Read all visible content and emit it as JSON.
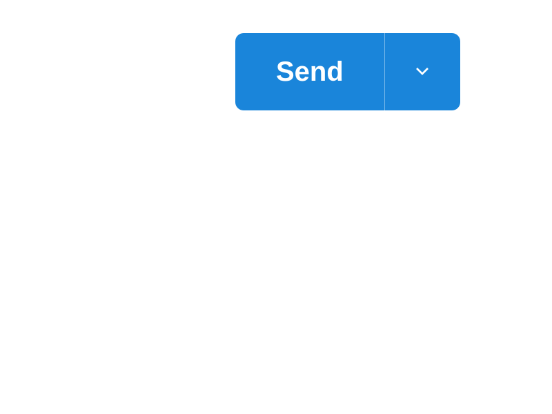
{
  "button": {
    "label": "Send"
  }
}
